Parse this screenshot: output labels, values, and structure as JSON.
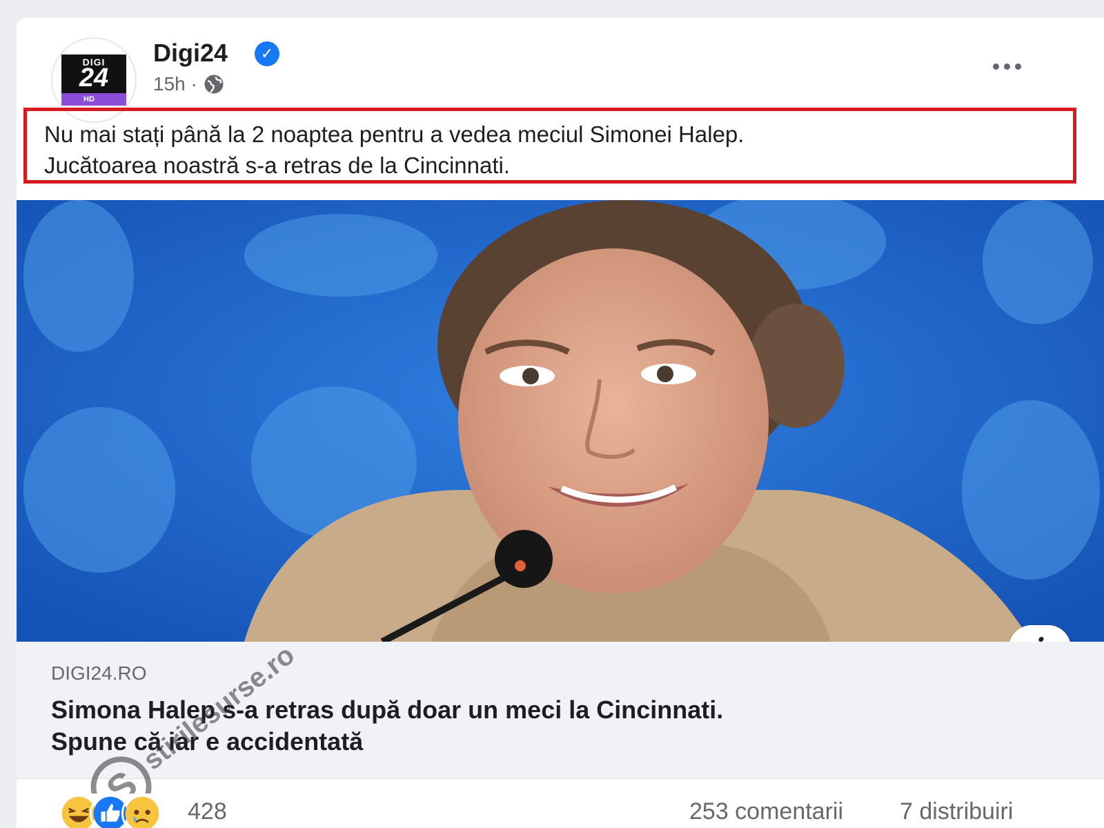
{
  "post": {
    "page_name": "Digi24",
    "time": "15h ·",
    "caption_line1": "Nu mai stați până la 2 noaptea pentru a vedea meciul Simonei Halep.",
    "caption_line2": "Jucătoarea noastră s-a  retras de la Cincinnati.",
    "logo": {
      "top": "DIGI",
      "number": "24",
      "badge": "HD"
    }
  },
  "link_preview": {
    "domain": "DIGI24.RO",
    "title_line1": "Simona Halep s-a retras după doar un meci la Cincinnati.",
    "title_line2": "Spune că iar e accidentată"
  },
  "engagement": {
    "reactions": [
      "haha-icon",
      "like-icon",
      "sad-icon"
    ],
    "reaction_count": "428",
    "comments": "253 comentarii",
    "shares": "7 distribuiri"
  },
  "watermark": "stirilesurse.ro",
  "colors": {
    "facebook_blue": "#1877f2",
    "highlight_red": "#d71920",
    "text_primary": "#1c1e21",
    "text_secondary": "#65676b"
  }
}
